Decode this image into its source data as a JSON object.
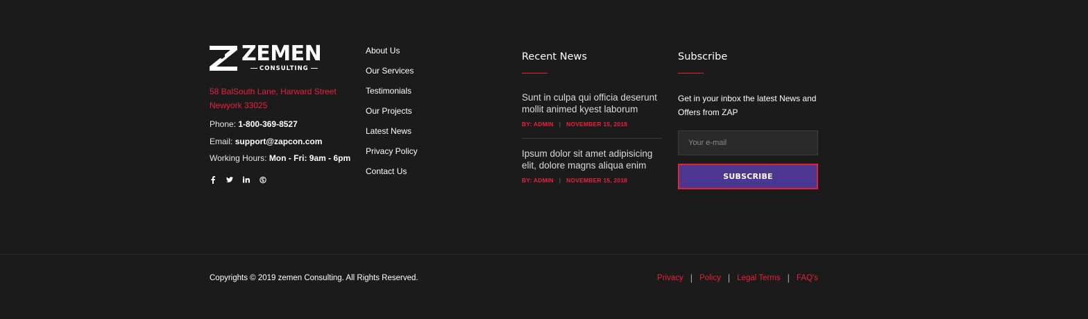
{
  "brand": {
    "name": "ZEMEN",
    "tagline": "CONSULTING"
  },
  "contact": {
    "address_line1": "58 BalSouth Lane, Harward Street",
    "address_line2": "Newyork 33025",
    "phone_label": "Phone: ",
    "phone_value": "1-800-369-8527",
    "email_label": "Email: ",
    "email_value": "support@zapcon.com",
    "hours_label": "Working Hours: ",
    "hours_value": "Mon - Fri: 9am - 6pm"
  },
  "social": [
    "facebook-icon",
    "twitter-icon",
    "linkedin-icon",
    "skype-icon"
  ],
  "links": [
    "About Us",
    "Our Services",
    "Testimonials",
    "Our Projects",
    "Latest News",
    "Privacy Policy",
    "Contact Us"
  ],
  "recent_news": {
    "heading": "Recent News",
    "items": [
      {
        "title": "Sunt in culpa qui officia deserunt mollit animed kyest laborum",
        "author": "BY: ADMIN",
        "date": "NOVEMBER 15, 2018"
      },
      {
        "title": "Ipsum dolor sit amet adipisicing elit, dolore magns aliqua enim",
        "author": "BY: ADMIN",
        "date": "NOVEMBER 15, 2018"
      }
    ]
  },
  "subscribe": {
    "heading": "Subscribe",
    "text": "Get in your inbox the latest News and Offers from ZAP",
    "placeholder": "Your e-mail",
    "button_label": "SUBSCRIBE"
  },
  "bottom": {
    "copyright": "Copyrights © 2019 zemen Consulting. All Rights Reserved.",
    "legal_links": [
      "Privacy",
      "Policy",
      "Legal Terms",
      "FAQ's"
    ],
    "separator": "|"
  },
  "colors": {
    "background": "#1b1b1b",
    "accent": "#e8213b",
    "button": "#4b3690"
  }
}
